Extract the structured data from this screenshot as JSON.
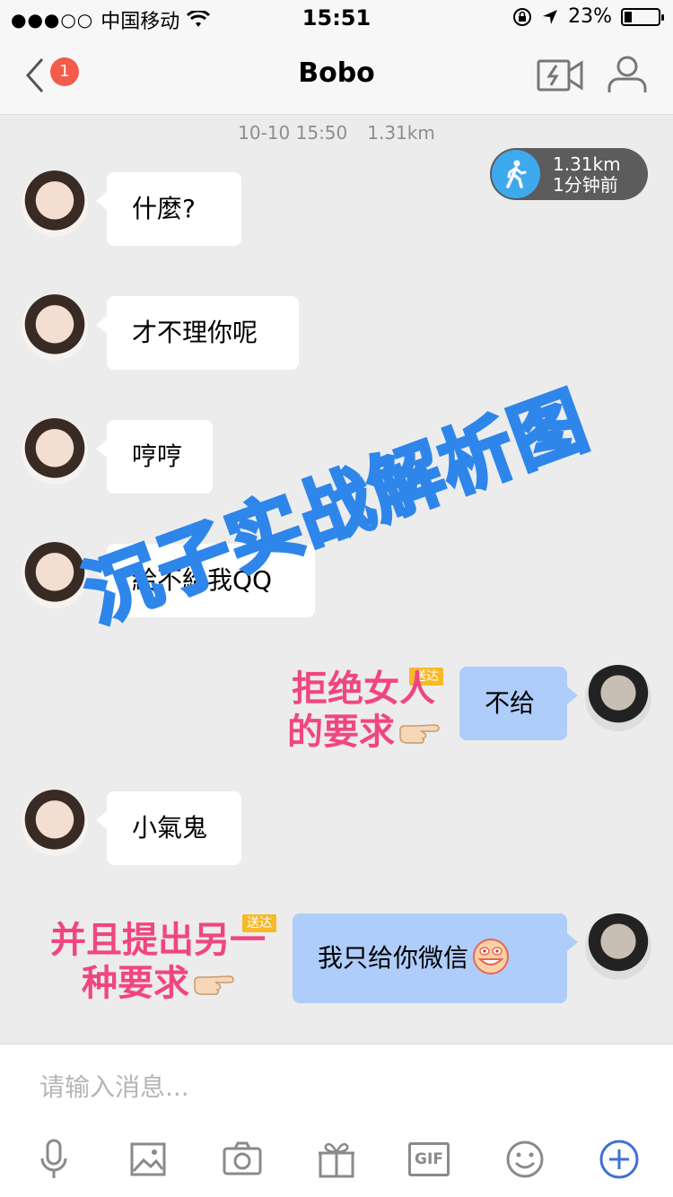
{
  "status_bar": {
    "signal": "●●●○○",
    "carrier": "中国移动",
    "time": "15:51",
    "battery_percent": "23%",
    "battery_level": 0.23
  },
  "nav": {
    "unread_count": "1",
    "title": "Bobo"
  },
  "chat": {
    "timestamp": "10-10 15:50",
    "distance": "1.31km",
    "pill_distance": "1.31km",
    "pill_time": "1分钟前",
    "messages": [
      {
        "from": "her",
        "text": "什麼?"
      },
      {
        "from": "her",
        "text": "才不理你呢"
      },
      {
        "from": "her",
        "text": "哼哼"
      },
      {
        "from": "her",
        "text": "給不給我QQ"
      },
      {
        "from": "me",
        "text": "不给"
      },
      {
        "from": "her",
        "text": "小氣鬼"
      },
      {
        "from": "me",
        "text": "我只给你微信"
      }
    ],
    "delivered_label": "送达"
  },
  "annotations": {
    "watermark": "沉子实战解析图",
    "note1_line1": "拒绝女人",
    "note1_line2": "的要求",
    "note2_line1": "并且提出另一",
    "note2_line2": "种要求"
  },
  "composer": {
    "placeholder": "请输入消息..."
  },
  "toolbar": {
    "icons": [
      "microphone-icon",
      "image-icon",
      "camera-icon",
      "gift-icon",
      "gif-icon",
      "emoji-icon",
      "plus-icon"
    ],
    "gif_label": "GIF"
  },
  "colors": {
    "incoming_bubble": "#ffffff",
    "outgoing_bubble": "#aecdfa",
    "badge": "#f35b4b",
    "annotation": "#f0467f",
    "watermark": "#2e86ea",
    "accent": "#3f6fd8"
  }
}
